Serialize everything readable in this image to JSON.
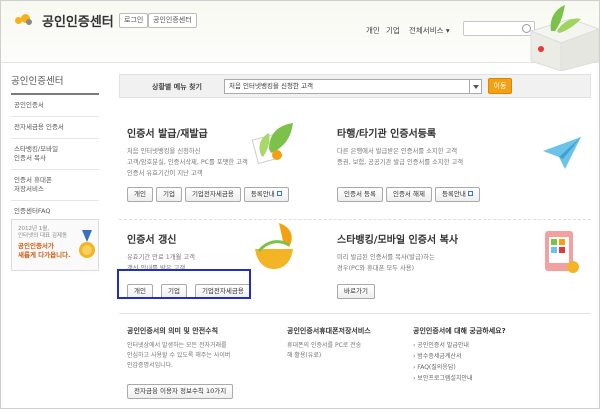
{
  "header": {
    "logo_text": "공인인증센터",
    "btn_login": "로그인",
    "btn_center": "공인인증센터",
    "nav": [
      "개인",
      "기업",
      "전체서비스 ▾"
    ]
  },
  "left_nav": {
    "title": "공인인증센터",
    "items": [
      "공인인증서",
      "전자세금용 인증서",
      "스타뱅킹/모바일\n인증서 복사",
      "인증서 휴대폰\n저장서비스",
      "인증센터FAQ"
    ],
    "banner_small": "2012년 1월,\n인터넷의 대표 김제동",
    "banner_bold": "공인인증서가\n새롭게 다가옵니다."
  },
  "situation": {
    "label": "상황별 메뉴 찾기",
    "selected": "처음 인터넷뱅킹을 신청한 고객",
    "go": "이동"
  },
  "cards": {
    "issue": {
      "title": "인증서 발급/재발급",
      "desc": [
        "처음 인터넷뱅킹을 신청하신",
        "고객/암호분실, 인증서삭제, PC를 포맷한 고객",
        "인증서 유효기간이 지난 고객"
      ],
      "buttons": [
        "개인",
        "기업",
        "기업전자세금용",
        "등록안내"
      ]
    },
    "other": {
      "title": "타행/타기관 인증서등록",
      "desc": [
        "다른 은행에서 발급받은 인증서를 소지한 고객",
        "증권, 보험, 공공기관 발급 인증서를 소지한 고객"
      ],
      "buttons": [
        "인증서 등록",
        "인증서 해제",
        "등록안내"
      ]
    },
    "renew": {
      "title": "인증서 갱신",
      "desc": [
        "유효기간 만료 1개월 고객",
        "갱신 안내를 받은 고객"
      ],
      "buttons": [
        "개인",
        "기업",
        "기업전자세금용"
      ]
    },
    "copy": {
      "title": "스타뱅킹/모바일 인증서 복사",
      "desc": [
        "미리 발급된 인증서를 복사(발급)하는",
        "경우(PC와 휴대폰 모두 사용)"
      ],
      "buttons": [
        "바로가기"
      ]
    }
  },
  "bottom": {
    "col1": {
      "title": "공인인증서의 의미 및 안전수칙",
      "desc": [
        "인터넷상에서 발생하는 모든 전자거래를",
        "안심하고 사용할 수 있도록 해주는 사이버",
        "인감증명서입니다."
      ],
      "button": "전자금융 이용자 정보수칙 10가지"
    },
    "col2": {
      "title": "공인인증서휴대폰저장서비스",
      "desc": [
        "휴대폰의 인증서를 PC로 전송",
        "해 활용(유료)"
      ]
    },
    "col3": {
      "title": "공인인증서에 대해 궁금하세요?",
      "links": [
        "› 공인인증서 발급안내",
        "› 범수증세금계산서",
        "› FAQ(질의응답)",
        "› 보안프로그램설치안내"
      ]
    }
  }
}
